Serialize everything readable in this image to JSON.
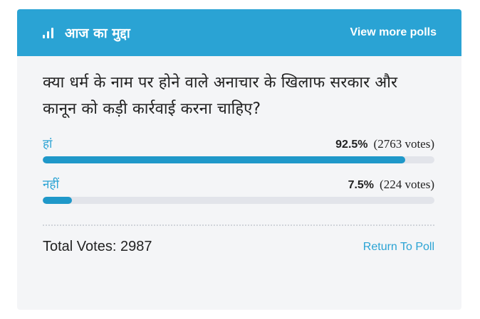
{
  "header": {
    "icon": "poll-bars-icon",
    "title": "आज का मुद्दा",
    "view_more": "View more polls"
  },
  "poll": {
    "question": "क्या धर्म के नाम पर होने वाले अनाचार के खिलाफ सरकार और कानून को कड़ी कार्रवाई करना चाहिए?",
    "options": [
      {
        "label": "हां",
        "percent_text": "92.5%",
        "votes_text": "(2763 votes)",
        "fraction": 0.925
      },
      {
        "label": "नहीं",
        "percent_text": "7.5%",
        "votes_text": "(224 votes)",
        "fraction": 0.075
      }
    ]
  },
  "footer": {
    "total": "Total Votes: 2987",
    "return": "Return To Poll"
  },
  "colors": {
    "accent": "#2aa3d4",
    "bar_fill": "#1f98c9",
    "bar_track": "#e2e4ea",
    "card_bg": "#f4f5f7"
  }
}
